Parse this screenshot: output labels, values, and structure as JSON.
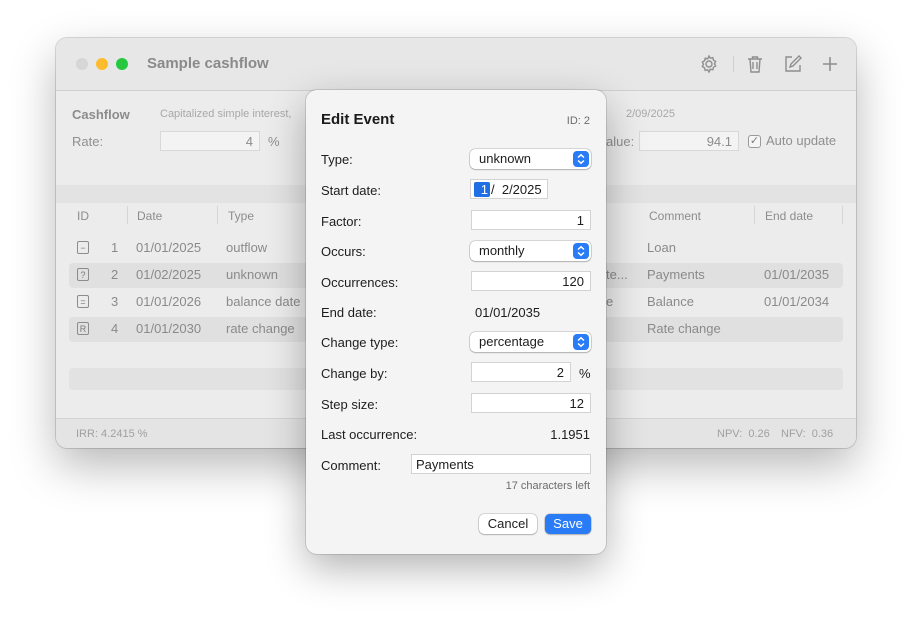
{
  "window": {
    "title": "Sample cashflow",
    "icons": [
      "gear-icon",
      "trash-icon",
      "compose-icon",
      "plus-icon"
    ]
  },
  "summary": {
    "title": "Cashflow",
    "description": "Capitalized simple interest,",
    "date_fragment": "2/09/2025",
    "rate_label": "Rate:",
    "rate_value": "4",
    "rate_unit": "%",
    "value_label": "alue:",
    "value_value": "94.1",
    "auto_update_label": "Auto update",
    "auto_update_checked": true
  },
  "table": {
    "columns": {
      "id": "ID",
      "date": "Date",
      "type": "Type",
      "comment": "Comment",
      "end_date": "End date"
    },
    "rows": [
      {
        "icon": "−",
        "id": "1",
        "date": "01/01/2025",
        "type": "outflow",
        "mid": "",
        "comment": "Loan",
        "end_date": ""
      },
      {
        "icon": "?",
        "id": "2",
        "date": "01/02/2025",
        "type": "unknown",
        "mid": "te...",
        "comment": "Payments",
        "end_date": "01/01/2035"
      },
      {
        "icon": "=",
        "id": "3",
        "date": "01/01/2026",
        "type": "balance date",
        "mid": "e",
        "comment": "Balance",
        "end_date": "01/01/2034"
      },
      {
        "icon": "R",
        "id": "4",
        "date": "01/01/2030",
        "type": "rate change",
        "mid": "",
        "comment": "Rate change",
        "end_date": ""
      }
    ]
  },
  "footer": {
    "irr": "IRR: 4.2415 %",
    "npv": "NPV:  0.26",
    "nfv": "NFV:  0.36"
  },
  "dialog": {
    "title": "Edit Event",
    "id_text": "ID: 2",
    "type_label": "Type:",
    "type_value": "unknown",
    "start_date_label": "Start date:",
    "start_date_selected": "1",
    "start_date_rest": "/  2/2025",
    "factor_label": "Factor:",
    "factor_value": "1",
    "occurs_label": "Occurs:",
    "occurs_value": "monthly",
    "occurrences_label": "Occurrences:",
    "occurrences_value": "120",
    "end_date_label": "End date:",
    "end_date_value": "01/01/2035",
    "change_type_label": "Change type:",
    "change_type_value": "percentage",
    "change_by_label": "Change by:",
    "change_by_value": "2",
    "change_by_unit": "%",
    "step_size_label": "Step size:",
    "step_size_value": "12",
    "last_occurrence_label": "Last occurrence:",
    "last_occurrence_value": "1.1951",
    "comment_label": "Comment:",
    "comment_value": "Payments",
    "chars_left": "17 characters left",
    "cancel_label": "Cancel",
    "save_label": "Save"
  },
  "colors": {
    "accent": "#2a7cf6",
    "close": "#d6d6d6",
    "minimize": "#fdbb2e",
    "maximize": "#27c840"
  }
}
